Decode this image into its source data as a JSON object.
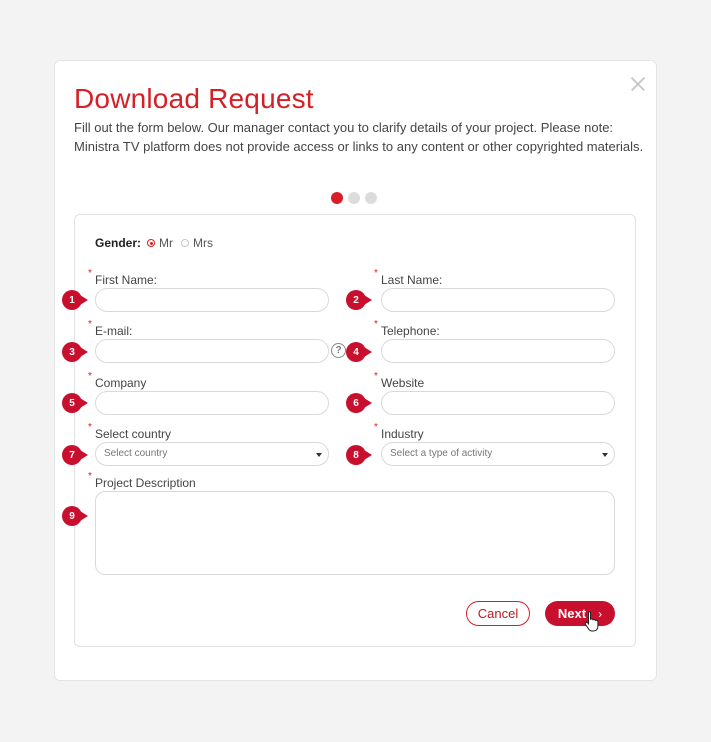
{
  "dialog": {
    "title": "Download Request",
    "intro_line1": "Fill out the form below. Our manager contact you to clarify details of your project. Please note:",
    "intro_line2": "Ministra TV platform does not provide access or links to any content or other copyrighted materials.",
    "step_current": 1,
    "step_total": 3
  },
  "form": {
    "gender": {
      "label": "Gender:",
      "options": [
        "Mr",
        "Mrs"
      ],
      "selected": "Mr"
    },
    "fields": {
      "first_name": {
        "label": "First Name:",
        "required_mark": "*",
        "badge": "1",
        "value": ""
      },
      "last_name": {
        "label": "Last Name:",
        "required_mark": "*",
        "badge": "2",
        "value": ""
      },
      "email": {
        "label": "E-mail:",
        "required_mark": "*",
        "badge": "3",
        "value": "",
        "help": "?"
      },
      "telephone": {
        "label": "Telephone:",
        "required_mark": "*",
        "badge": "4",
        "value": ""
      },
      "company": {
        "label": "Company",
        "required_mark": "*",
        "badge": "5",
        "value": ""
      },
      "website": {
        "label": "Website",
        "required_mark": "*",
        "badge": "6",
        "value": ""
      },
      "country": {
        "label": "Select country",
        "required_mark": "*",
        "badge": "7",
        "selected": "Select country"
      },
      "industry": {
        "label": "Industry",
        "required_mark": "*",
        "badge": "8",
        "selected": "Select a type of activity"
      },
      "description": {
        "label": "Project Description",
        "required_mark": "*",
        "badge": "9",
        "value": ""
      }
    },
    "buttons": {
      "cancel": "Cancel",
      "next": "Next",
      "next_chevron": "›"
    }
  },
  "colors": {
    "accent": "#d61f26",
    "badge": "#c8102e"
  }
}
